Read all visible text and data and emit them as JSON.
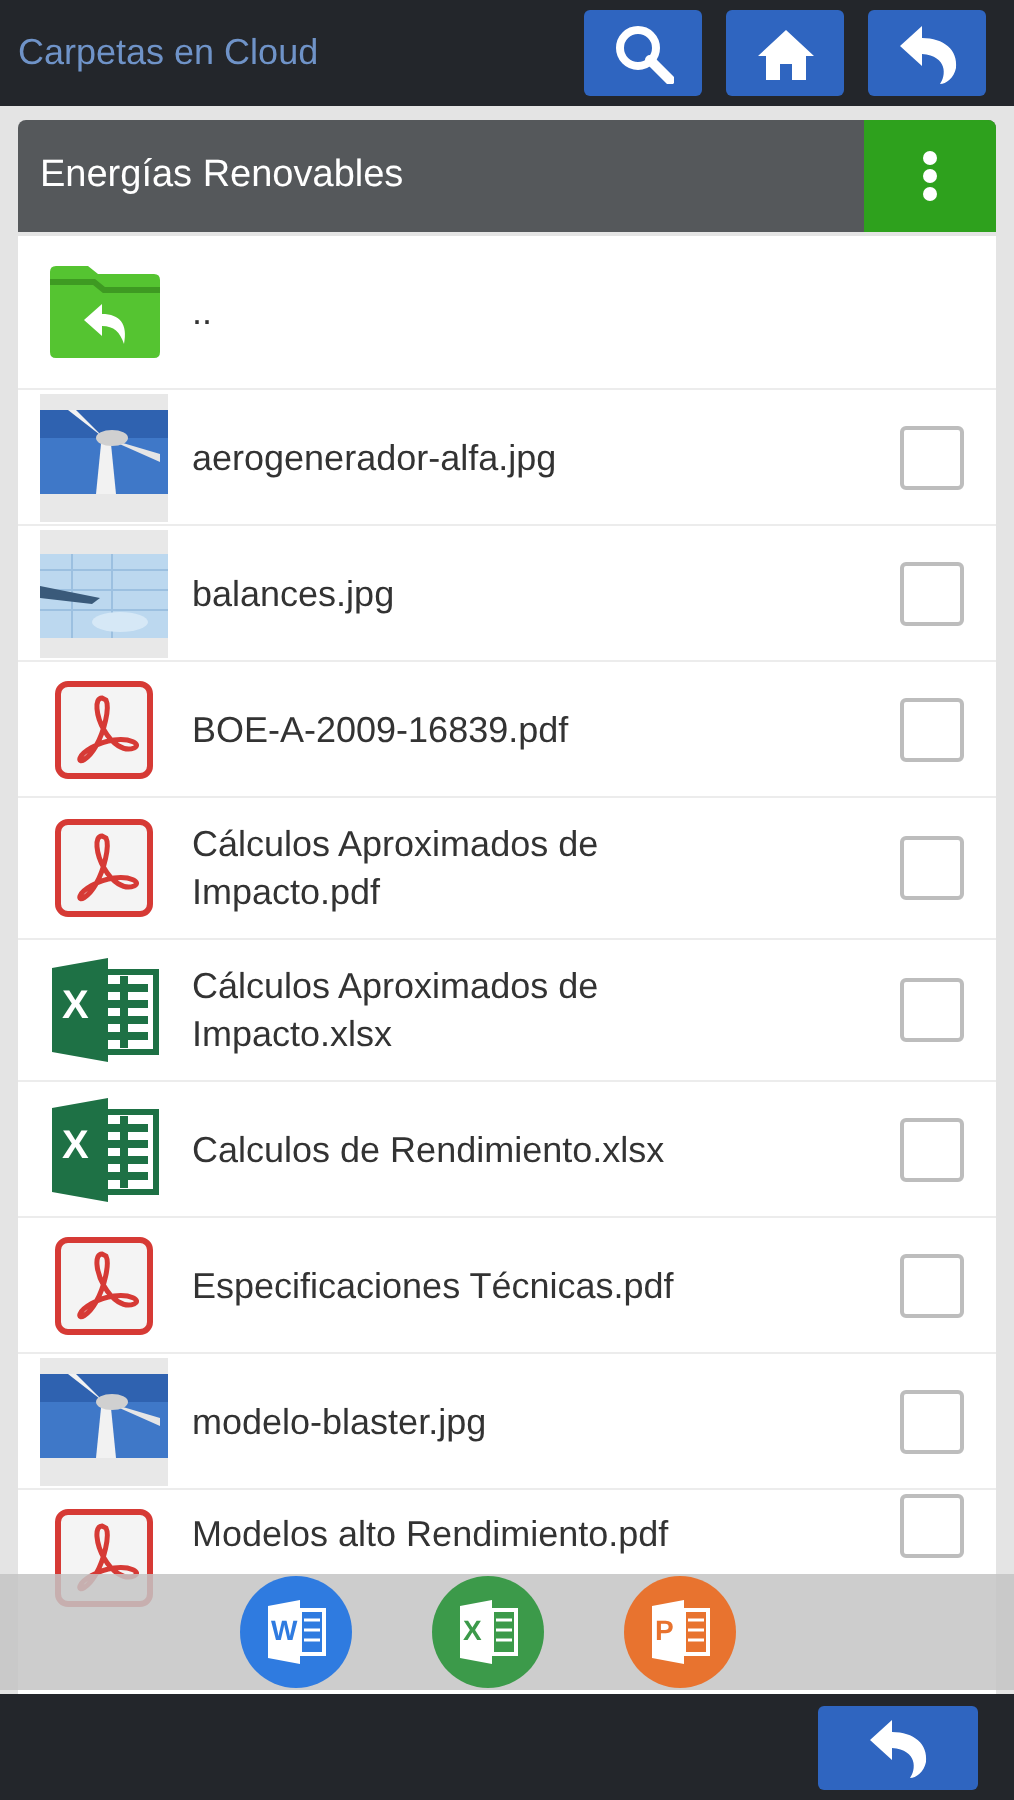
{
  "header": {
    "title": "Carpetas en Cloud",
    "buttons": [
      {
        "kind": "search"
      },
      {
        "kind": "home"
      },
      {
        "kind": "back"
      }
    ]
  },
  "folder": {
    "title": "Energías Renovables"
  },
  "files": [
    {
      "kind": "up",
      "name": ".."
    },
    {
      "name": "aerogenerador-alfa.jpg",
      "checked": false
    },
    {
      "kind": "image2",
      "name": "balances.jpg",
      "checked": false
    },
    {
      "kind": "pdf",
      "name": "BOE-A-2009-16839.pdf",
      "checked": false
    },
    {
      "kind": "pdf",
      "name": "Cálculos Aproximados de Impacto.pdf",
      "checked": false
    },
    {
      "kind": "excel",
      "badge": "X",
      "name": "Cálculos Aproximados de Impacto.xlsx",
      "checked": false
    },
    {
      "kind": "excel",
      "badge": "X",
      "name": "Calculos de Rendimiento.xlsx",
      "checked": false
    },
    {
      "kind": "pdf",
      "name": "Especificaciones Técnicas.pdf",
      "checked": false
    },
    {
      "name": "modelo-blaster.jpg",
      "checked": false
    },
    {
      "kind": "pdf",
      "name": "Modelos alto Rendimiento.pdf",
      "checked": false
    }
  ],
  "new_document_bar": [
    {
      "kind": "word",
      "letter": "W"
    },
    {
      "kind": "excel",
      "letter": "X"
    },
    {
      "kind": "powerpoint",
      "letter": "P"
    }
  ]
}
